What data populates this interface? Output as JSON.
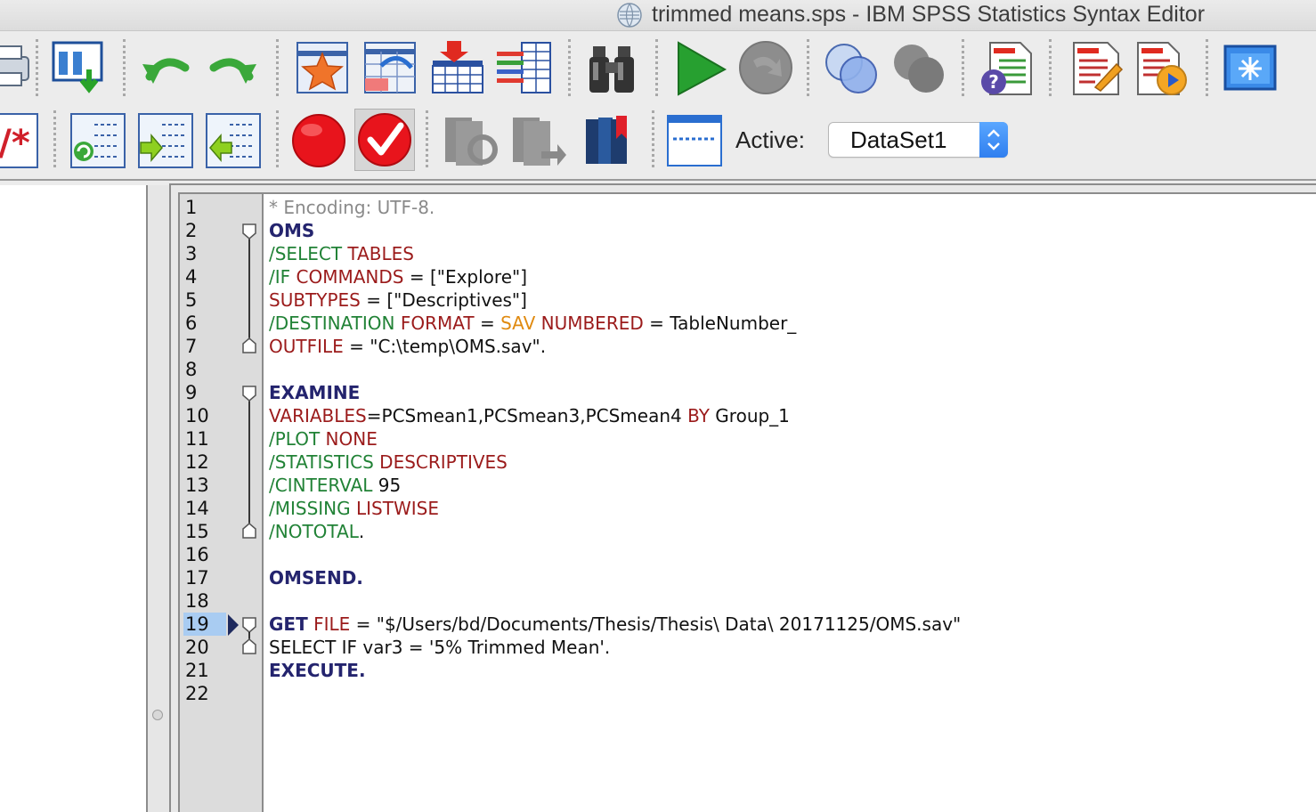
{
  "window": {
    "title": "trimmed means.sps - IBM SPSS Statistics Syntax Editor"
  },
  "toolbar": {
    "active_label": "Active:",
    "dataset_value": "DataSet1"
  },
  "editor": {
    "active_line": "19",
    "lines": [
      {
        "n": "1",
        "tokens": [
          {
            "t": "* Encoding: UTF-8.",
            "k": "comment"
          }
        ]
      },
      {
        "n": "2",
        "tokens": [
          {
            "t": "OMS",
            "k": "command"
          }
        ]
      },
      {
        "n": "3",
        "tokens": [
          {
            "t": "/SELECT",
            "k": "sub"
          },
          {
            "t": " TABLES",
            "k": "keyword"
          }
        ]
      },
      {
        "n": "4",
        "tokens": [
          {
            "t": "/IF",
            "k": "sub"
          },
          {
            "t": " COMMANDS",
            "k": "keyword"
          },
          {
            "t": " = [\"Explore\"]",
            "k": "plain"
          }
        ]
      },
      {
        "n": "5",
        "tokens": [
          {
            "t": "SUBTYPES",
            "k": "keyword"
          },
          {
            "t": " = [\"Descriptives\"]",
            "k": "plain"
          }
        ]
      },
      {
        "n": "6",
        "tokens": [
          {
            "t": "/DESTINATION",
            "k": "sub"
          },
          {
            "t": " FORMAT",
            "k": "keyword"
          },
          {
            "t": " = ",
            "k": "plain"
          },
          {
            "t": "SAV",
            "k": "orange"
          },
          {
            "t": " NUMBERED",
            "k": "keyword"
          },
          {
            "t": " = TableNumber_",
            "k": "plain"
          }
        ]
      },
      {
        "n": "7",
        "tokens": [
          {
            "t": "OUTFILE",
            "k": "keyword"
          },
          {
            "t": " = \"C:\\temp\\OMS.sav\".",
            "k": "plain"
          }
        ]
      },
      {
        "n": "8",
        "tokens": []
      },
      {
        "n": "9",
        "tokens": [
          {
            "t": "EXAMINE",
            "k": "command"
          }
        ]
      },
      {
        "n": "10",
        "tokens": [
          {
            "t": "VARIABLES",
            "k": "keyword"
          },
          {
            "t": "=PCSmean1,PCSmean3,PCSmean4 ",
            "k": "plain"
          },
          {
            "t": "BY",
            "k": "keyword"
          },
          {
            "t": " Group_1",
            "k": "plain"
          }
        ]
      },
      {
        "n": "11",
        "tokens": [
          {
            "t": "/PLOT",
            "k": "sub"
          },
          {
            "t": " NONE",
            "k": "keyword"
          }
        ]
      },
      {
        "n": "12",
        "tokens": [
          {
            "t": "/STATISTICS",
            "k": "sub"
          },
          {
            "t": " DESCRIPTIVES",
            "k": "keyword"
          }
        ]
      },
      {
        "n": "13",
        "tokens": [
          {
            "t": "/CINTERVAL",
            "k": "sub"
          },
          {
            "t": " 95",
            "k": "plain"
          }
        ]
      },
      {
        "n": "14",
        "tokens": [
          {
            "t": "/MISSING",
            "k": "sub"
          },
          {
            "t": " LISTWISE",
            "k": "keyword"
          }
        ]
      },
      {
        "n": "15",
        "tokens": [
          {
            "t": "/NOTOTAL",
            "k": "sub"
          },
          {
            "t": ".",
            "k": "plain"
          }
        ]
      },
      {
        "n": "16",
        "tokens": []
      },
      {
        "n": "17",
        "tokens": [
          {
            "t": "OMSEND.",
            "k": "command"
          }
        ]
      },
      {
        "n": "18",
        "tokens": []
      },
      {
        "n": "19",
        "tokens": [
          {
            "t": "GET",
            "k": "command"
          },
          {
            "t": " FILE",
            "k": "keyword"
          },
          {
            "t": " = \"$/Users/bd/Documents/Thesis/Thesis\\ Data\\ 20171125/OMS.sav\"",
            "k": "plain"
          }
        ]
      },
      {
        "n": "20",
        "tokens": [
          {
            "t": "SELECT IF var3 = '5% Trimmed Mean'.",
            "k": "plain"
          }
        ]
      },
      {
        "n": "21",
        "tokens": [
          {
            "t": "EXECUTE.",
            "k": "command"
          }
        ]
      },
      {
        "n": "22",
        "tokens": []
      }
    ]
  },
  "colors": {
    "command": "#24246e",
    "subcommand": "#218236",
    "keyword": "#9b1b1b",
    "orange_keyword": "#e08a10",
    "comment": "#8a8a8a",
    "active_line_bg": "#a9ccf2"
  },
  "icons": {
    "toolbar1": [
      "print-icon",
      "goto-data-icon",
      "undo-icon",
      "redo-icon",
      "goto-case-icon",
      "goto-variable-icon",
      "insert-cases-icon",
      "variables-icon",
      "find-icon",
      "run-selection-icon",
      "stop-processor-icon",
      "split-file-icon",
      "select-cases-icon",
      "syntax-help-icon",
      "show-dialog-icon",
      "run-to-end-icon",
      "designate-window-icon"
    ],
    "toolbar2": [
      "comment-toggle-icon",
      "step-through-icon",
      "step-forward-icon",
      "step-back-icon",
      "breakpoint-icon",
      "validate-icon",
      "next-bookmark-icon",
      "previous-bookmark-icon",
      "bookmark-icon",
      "toggle-panel-icon"
    ]
  }
}
